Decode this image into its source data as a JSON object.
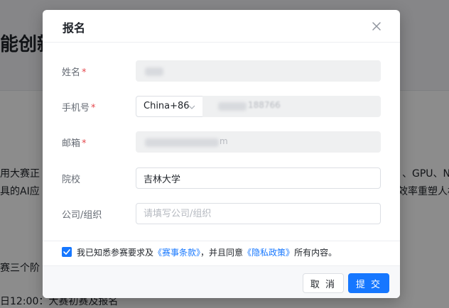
{
  "background": {
    "title": "能创新",
    "line1_left": "用大赛正",
    "line1_right": "、GPU、N",
    "line2_left": "具的AI应",
    "line2_right": "效率重塑人机",
    "line3_left": "赛三个阶",
    "line4_left": "日12:00：大赛初赛及报名"
  },
  "modal": {
    "title": "报名",
    "close_icon": "close-icon",
    "fields": {
      "name": {
        "label": "姓名",
        "required_mark": "*"
      },
      "phone": {
        "label": "手机号",
        "required_mark": "*",
        "country_code": "China+86",
        "masked_value": "188766"
      },
      "email": {
        "label": "邮箱",
        "required_mark": "*",
        "masked_suffix": "m"
      },
      "school": {
        "label": "院校",
        "value": "吉林大学"
      },
      "company": {
        "label": "公司/组织",
        "placeholder": "请填写公司/组织"
      }
    },
    "agreement": {
      "checked": true,
      "prefix": "我已知悉参赛要求及",
      "terms_link": "《赛事条款》",
      "middle": "，并且同意",
      "privacy_link": "《隐私政策》",
      "suffix": "所有内容。"
    },
    "buttons": {
      "cancel": "取 消",
      "submit": "提 交"
    }
  },
  "colors": {
    "primary": "#1677ff",
    "required": "#e5484d",
    "disabled_field": "#eff0f1"
  }
}
